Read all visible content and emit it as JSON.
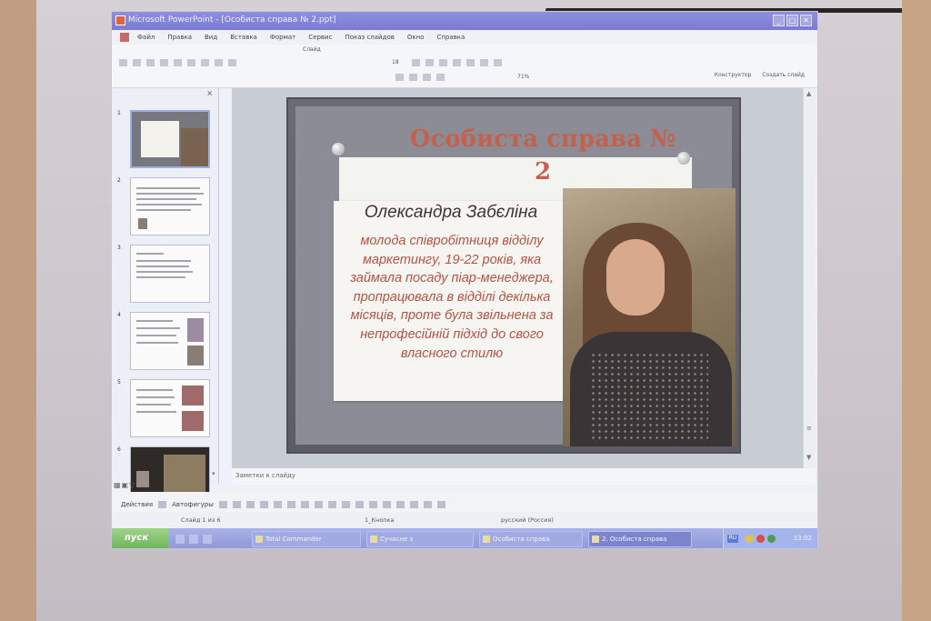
{
  "window": {
    "title": "Microsoft PowerPoint - [Особиста справа № 2.ppt]",
    "controls": [
      "_",
      "□",
      "✕"
    ]
  },
  "menu": [
    "Файл",
    "Правка",
    "Вид",
    "Вставка",
    "Формат",
    "Сервис",
    "Показ слайдов",
    "Окно",
    "Справка"
  ],
  "toolbar": {
    "design_label": "Слайд",
    "font_size": "18",
    "zoom": "71%",
    "constructor_label": "Конструктор",
    "new_slide_label": "Создать слайд"
  },
  "slides_panel": {
    "numbers": [
      "1",
      "2",
      "3",
      "4",
      "5",
      "6"
    ],
    "selected": 1
  },
  "slide": {
    "title": "Особиста справа № 2",
    "name": "Олександра Забєліна",
    "body": "молода співробітниця відділу маркетингу, 19-22 років, яка займала посаду піар-менеджера, пропрацювала в відділі декілька місяців, проте була звільнена за непрофесійній підхід до свого власного стилю",
    "colors": {
      "title": "#c2624e",
      "body": "#b45442",
      "name": "#3a3636"
    }
  },
  "notes_placeholder": "Заметки к слайду",
  "drawing_toolbar": {
    "actions_label": "Действия",
    "autoshapes_label": "Автофигуры"
  },
  "statusbar": {
    "slide_counter": "Слайд 1 из 6",
    "design_name": "1_Кнопка",
    "language": "русский (Россия)"
  },
  "taskbar": {
    "start_label": "пуск",
    "items": [
      "Total Commander",
      "Сучасне з",
      "Особистa справа",
      "2. Особиста справа"
    ],
    "active_index": 3,
    "clock": "13:02"
  }
}
